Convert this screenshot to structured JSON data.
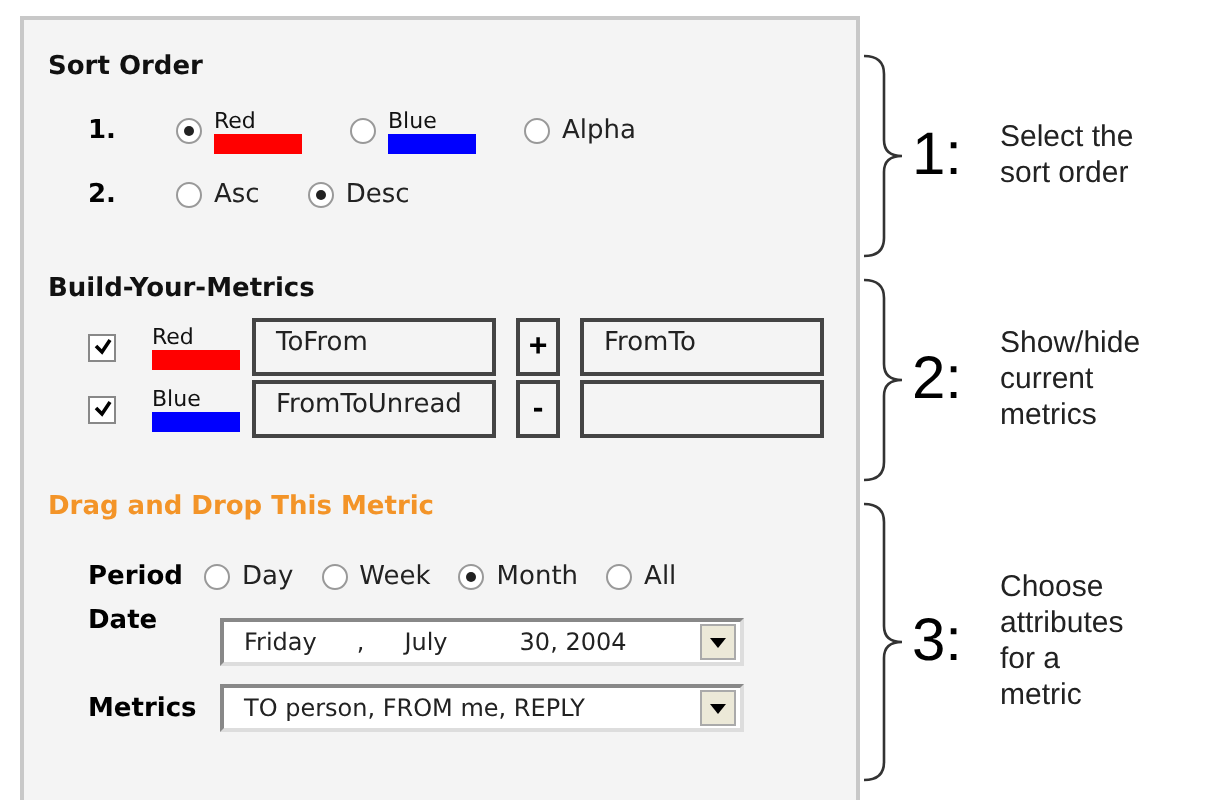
{
  "sort_order": {
    "title": "Sort Order",
    "rows": [
      {
        "number": "1.",
        "options": [
          {
            "label": "Red",
            "color": "#ff0000",
            "selected": true
          },
          {
            "label": "Blue",
            "color": "#0000ff",
            "selected": false
          },
          {
            "label": "Alpha",
            "selected": false
          }
        ]
      },
      {
        "number": "2.",
        "options": [
          {
            "label": "Asc",
            "selected": false
          },
          {
            "label": "Desc",
            "selected": true
          }
        ]
      }
    ]
  },
  "build_metrics": {
    "title": "Build-Your-Metrics",
    "rows": [
      {
        "checked": true,
        "label": "Red",
        "color": "#ff0000",
        "metric": "ToFrom",
        "operator": "+",
        "operand": "FromTo"
      },
      {
        "checked": true,
        "label": "Blue",
        "color": "#0000ff",
        "metric": "FromToUnread",
        "operator": "-"
      }
    ]
  },
  "drag_drop": {
    "title": "Drag and Drop This Metric",
    "period": {
      "label": "Period",
      "options": [
        {
          "label": "Day",
          "selected": false
        },
        {
          "label": "Week",
          "selected": false
        },
        {
          "label": "Month",
          "selected": true
        },
        {
          "label": "All",
          "selected": false
        }
      ]
    },
    "date": {
      "label": "Date",
      "weekday": "Friday",
      "separator": ",",
      "month": "July",
      "day_year": "30, 2004"
    },
    "metrics": {
      "label": "Metrics",
      "value": "TO person, FROM me, REPLY"
    }
  },
  "annotations": [
    {
      "number": "1:",
      "lines": [
        "Select the",
        "sort order"
      ]
    },
    {
      "number": "2:",
      "lines": [
        "Show/hide",
        "current",
        "metrics"
      ]
    },
    {
      "number": "3:",
      "lines": [
        "Choose",
        "attributes",
        "for  a",
        "metric"
      ]
    }
  ]
}
